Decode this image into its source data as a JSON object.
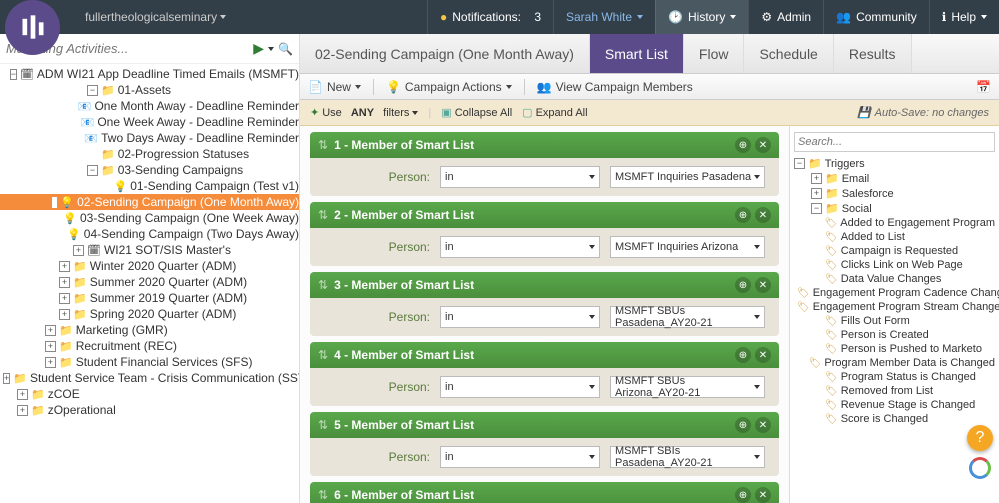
{
  "header": {
    "org": "fullertheologicalseminary",
    "notifications_label": "Notifications:",
    "notifications_count": "3",
    "user": "Sarah White",
    "history": "History",
    "admin": "Admin",
    "community": "Community",
    "help": "Help"
  },
  "left": {
    "search_placeholder": "Marketing Activities...",
    "tree": [
      {
        "d": 5,
        "t": "minus",
        "i": "prog",
        "label": "ADM WI21 App Deadline Timed Emails (MSMFT)"
      },
      {
        "d": 6,
        "t": "minus",
        "i": "folder",
        "label": "01-Assets"
      },
      {
        "d": 7,
        "t": "none",
        "i": "mail",
        "label": "One Month Away - Deadline Reminder"
      },
      {
        "d": 7,
        "t": "none",
        "i": "mail",
        "label": "One Week Away - Deadline Reminder"
      },
      {
        "d": 7,
        "t": "none",
        "i": "mail",
        "label": "Two Days Away - Deadline Reminder"
      },
      {
        "d": 6,
        "t": "none",
        "i": "folder",
        "label": "02-Progression Statuses"
      },
      {
        "d": 6,
        "t": "minus",
        "i": "folder",
        "label": "03-Sending Campaigns"
      },
      {
        "d": 7,
        "t": "none",
        "i": "bulb",
        "label": "01-Sending Campaign (Test v1)"
      },
      {
        "d": 7,
        "t": "none",
        "i": "bulb",
        "label": "02-Sending Campaign (One Month Away)",
        "sel": true
      },
      {
        "d": 7,
        "t": "none",
        "i": "bulb",
        "label": "03-Sending Campaign (One Week Away)"
      },
      {
        "d": 7,
        "t": "none",
        "i": "bulb",
        "label": "04-Sending Campaign (Two Days Away)"
      },
      {
        "d": 5,
        "t": "plus",
        "i": "prog",
        "label": "WI21 SOT/SIS Master's"
      },
      {
        "d": 4,
        "t": "plus",
        "i": "folder",
        "label": "Winter 2020 Quarter (ADM)"
      },
      {
        "d": 4,
        "t": "plus",
        "i": "folder",
        "label": "Summer 2020 Quarter (ADM)"
      },
      {
        "d": 4,
        "t": "plus",
        "i": "folder",
        "label": "Summer 2019 Quarter (ADM)"
      },
      {
        "d": 4,
        "t": "plus",
        "i": "folder",
        "label": "Spring 2020 Quarter (ADM)"
      },
      {
        "d": 3,
        "t": "plus",
        "i": "folder",
        "label": "Marketing (GMR)"
      },
      {
        "d": 3,
        "t": "plus",
        "i": "folder",
        "label": "Recruitment (REC)"
      },
      {
        "d": 3,
        "t": "plus",
        "i": "folder",
        "label": "Student Financial Services (SFS)"
      },
      {
        "d": 2,
        "t": "plus",
        "i": "folder",
        "label": "Student Service Team - Crisis Communication (SSTCC)"
      },
      {
        "d": 1,
        "t": "plus",
        "i": "folder",
        "label": "zCOE"
      },
      {
        "d": 1,
        "t": "plus",
        "i": "folder",
        "label": "zOperational"
      }
    ]
  },
  "tabs": {
    "main": "02-Sending Campaign (One Month Away)",
    "items": [
      "Smart List",
      "Flow",
      "Schedule",
      "Results"
    ],
    "active": 0
  },
  "toolbar": {
    "new": "New",
    "actions": "Campaign Actions",
    "view_members": "View Campaign Members"
  },
  "filter_bar": {
    "use": "Use",
    "any": "ANY",
    "filters": "filters",
    "collapse": "Collapse All",
    "expand": "Expand All",
    "autosave": "Auto-Save: no changes"
  },
  "filters": [
    {
      "n": "1",
      "title": "Member of Smart List",
      "op": "in",
      "val": "MSMFT Inquiries Pasadena"
    },
    {
      "n": "2",
      "title": "Member of Smart List",
      "op": "in",
      "val": "MSMFT Inquiries Arizona"
    },
    {
      "n": "3",
      "title": "Member of Smart List",
      "op": "in",
      "val": "MSMFT SBUs Pasadena_AY20-21"
    },
    {
      "n": "4",
      "title": "Member of Smart List",
      "op": "in",
      "val": "MSMFT SBUs Arizona_AY20-21"
    },
    {
      "n": "5",
      "title": "Member of Smart List",
      "op": "in",
      "val": "MSMFT SBIs Pasadena_AY20-21"
    },
    {
      "n": "6",
      "title": "Member of Smart List",
      "op": "",
      "val": ""
    }
  ],
  "filter_labels": {
    "person": "Person:"
  },
  "triggers": {
    "search_placeholder": "Search...",
    "root": "Triggers",
    "groups": [
      {
        "label": "Email",
        "open": false
      },
      {
        "label": "Salesforce",
        "open": false
      },
      {
        "label": "Social",
        "open": true,
        "children": [
          "Added to Engagement Program",
          "Added to List",
          "Campaign is Requested",
          "Clicks Link on Web Page",
          "Data Value Changes",
          "Engagement Program Cadence Changes",
          "Engagement Program Stream Changes",
          "Fills Out Form",
          "Person is Created",
          "Person is Pushed to Marketo",
          "Program Member Data is Changed",
          "Program Status is Changed",
          "Removed from List",
          "Revenue Stage is Changed",
          "Score is Changed"
        ]
      }
    ]
  },
  "badge": "?"
}
